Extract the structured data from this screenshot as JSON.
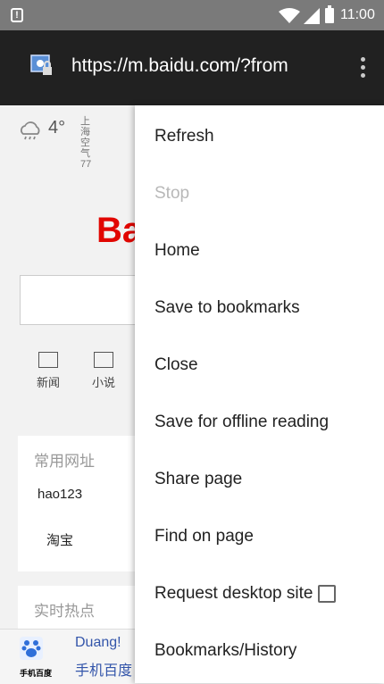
{
  "status_bar": {
    "time": "11:00",
    "alert_glyph": "!"
  },
  "toolbar": {
    "url": "https://m.baidu.com/?from"
  },
  "background_page": {
    "weather": {
      "temperature": "4°",
      "city": "上海",
      "air_quality": "空气 77"
    },
    "logo": "Ba",
    "nav_items": [
      {
        "label": "新闻"
      },
      {
        "label": "小说"
      }
    ],
    "common_sites": {
      "heading": "常用网址",
      "links": [
        "hao123",
        "淘宝"
      ]
    },
    "hot_topics": {
      "heading": "实时热点"
    },
    "app_banner": {
      "app_name": "手机百度",
      "line1": "Duang!",
      "line2": "手机百度"
    }
  },
  "menu": {
    "items": [
      {
        "label": "Refresh",
        "enabled": true
      },
      {
        "label": "Stop",
        "enabled": false
      },
      {
        "label": "Home",
        "enabled": true
      },
      {
        "label": "Save to bookmarks",
        "enabled": true
      },
      {
        "label": "Close",
        "enabled": true
      },
      {
        "label": "Save for offline reading",
        "enabled": true
      },
      {
        "label": "Share page",
        "enabled": true
      },
      {
        "label": "Find on page",
        "enabled": true
      },
      {
        "label": "Request desktop site",
        "enabled": true,
        "checked": false
      },
      {
        "label": "Bookmarks/History",
        "enabled": true
      }
    ]
  },
  "colors": {
    "toolbar": "#212121",
    "status_bar": "#7a7a7a",
    "baidu_red": "#e10601",
    "menu_bg": "#ffffff",
    "disabled_text": "#b8b8b8"
  }
}
